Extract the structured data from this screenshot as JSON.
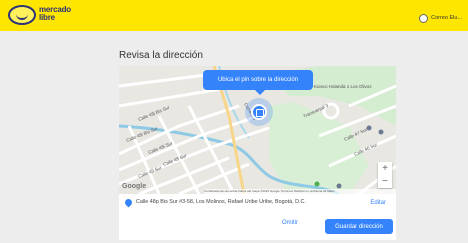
{
  "header": {
    "logo_line1": "mercado",
    "logo_line2": "libre",
    "user_label": "Correo Elu..."
  },
  "page": {
    "title": "Revisa la dirección"
  },
  "map": {
    "tooltip": "Ubica el pin sobre la dirección",
    "zoom_in": "+",
    "zoom_out": "−",
    "google_label": "Google",
    "attribution": "Combinaciones de teclas   Datos del mapa ©2023 Google   Términos   Notificar un problema de Maps",
    "street_labels": [
      "Calle 48j Bis Sur",
      "Calle 48i Bis Sur",
      "Calle 48i Sur",
      "Calle 48 Sur",
      "Calle 49 Sur",
      "Carrera 3",
      "Calle 47 Sur",
      "Calle 46 Sur",
      "Transversal 3"
    ],
    "poi_label": "Kiosco Holanda 1 Los Olivos"
  },
  "address": {
    "text": "Calle 48p Bis Sur #3-58, Los Molinos, Rafael Uribe Uribe, Bogotá, D.C.",
    "edit_label": "Editar"
  },
  "actions": {
    "omit_label": "Omitir",
    "save_label": "Guardar dirección"
  },
  "colors": {
    "topbar": "#ffe600",
    "accent": "#3483fa",
    "background": "#ededed"
  }
}
